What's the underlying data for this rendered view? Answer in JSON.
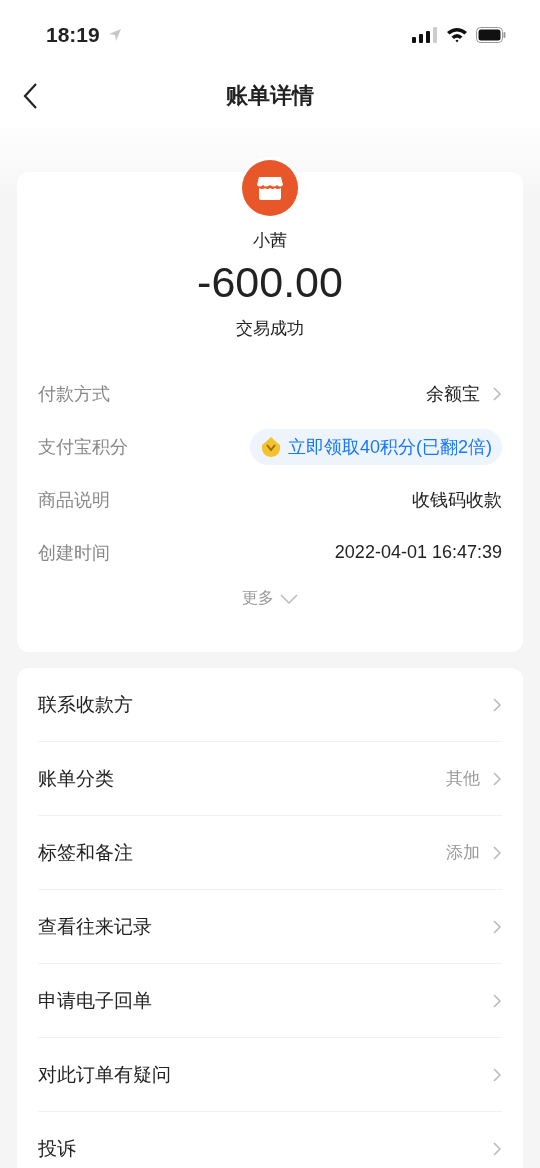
{
  "status_bar": {
    "time": "18:19"
  },
  "nav": {
    "title": "账单详情"
  },
  "summary": {
    "name": "小茜",
    "amount": "-600.00",
    "status": "交易成功"
  },
  "details": [
    {
      "kind": "link",
      "label": "付款方式",
      "value": "余额宝"
    },
    {
      "kind": "badge",
      "label": "支付宝积分",
      "value": "立即领取40积分(已翻2倍)"
    },
    {
      "kind": "plain",
      "label": "商品说明",
      "value": "收钱码收款"
    },
    {
      "kind": "plain",
      "label": "创建时间",
      "value": "2022-04-01 16:47:39"
    }
  ],
  "more": {
    "label": "更多",
    "expanded": false
  },
  "menu": [
    {
      "label": "联系收款方"
    },
    {
      "label": "账单分类",
      "value": "其他"
    },
    {
      "label": "标签和备注",
      "value": "添加"
    },
    {
      "label": "查看往来记录"
    },
    {
      "label": "申请电子回单"
    },
    {
      "label": "对此订单有疑问"
    },
    {
      "label": "投诉"
    }
  ]
}
